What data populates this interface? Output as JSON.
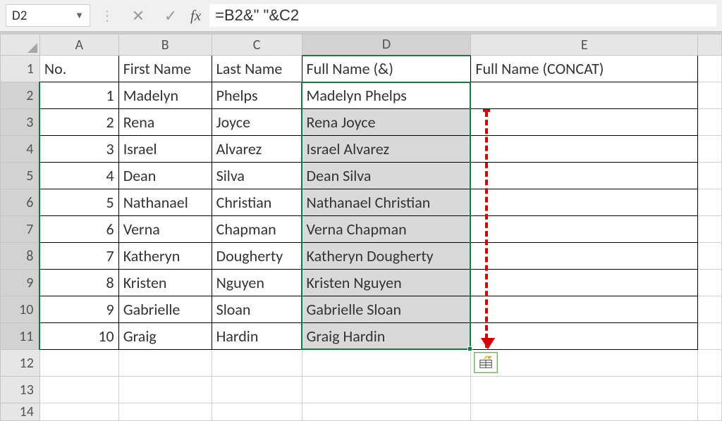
{
  "formula_bar": {
    "name_box": "D2",
    "formula": "=B2&\" \"&C2",
    "fx_label": "fx"
  },
  "columns": [
    "A",
    "B",
    "C",
    "D",
    "E"
  ],
  "selected_column": "D",
  "row_numbers": [
    1,
    2,
    3,
    4,
    5,
    6,
    7,
    8,
    9,
    10,
    11,
    12,
    13,
    14
  ],
  "selected_rows_start": 2,
  "selected_rows_end": 11,
  "headers": {
    "A": "No.",
    "B": "First Name",
    "C": "Last Name",
    "D": "Full Name (&)",
    "E": "Full Name (CONCAT)"
  },
  "rows": [
    {
      "no": 1,
      "first": "Madelyn",
      "last": "Phelps",
      "full": "Madelyn Phelps"
    },
    {
      "no": 2,
      "first": "Rena",
      "last": "Joyce",
      "full": "Rena Joyce"
    },
    {
      "no": 3,
      "first": "Israel",
      "last": "Alvarez",
      "full": "Israel Alvarez"
    },
    {
      "no": 4,
      "first": "Dean",
      "last": "Silva",
      "full": "Dean Silva"
    },
    {
      "no": 5,
      "first": "Nathanael",
      "last": "Christian",
      "full": "Nathanael Christian"
    },
    {
      "no": 6,
      "first": "Verna",
      "last": "Chapman",
      "full": "Verna Chapman"
    },
    {
      "no": 7,
      "first": "Katheryn",
      "last": "Dougherty",
      "full": "Katheryn Dougherty"
    },
    {
      "no": 8,
      "first": "Kristen",
      "last": "Nguyen",
      "full": "Kristen Nguyen"
    },
    {
      "no": 9,
      "first": "Gabrielle",
      "last": "Sloan",
      "full": "Gabrielle Sloan"
    },
    {
      "no": 10,
      "first": "Graig",
      "last": "Hardin",
      "full": "Graig Hardin"
    }
  ]
}
